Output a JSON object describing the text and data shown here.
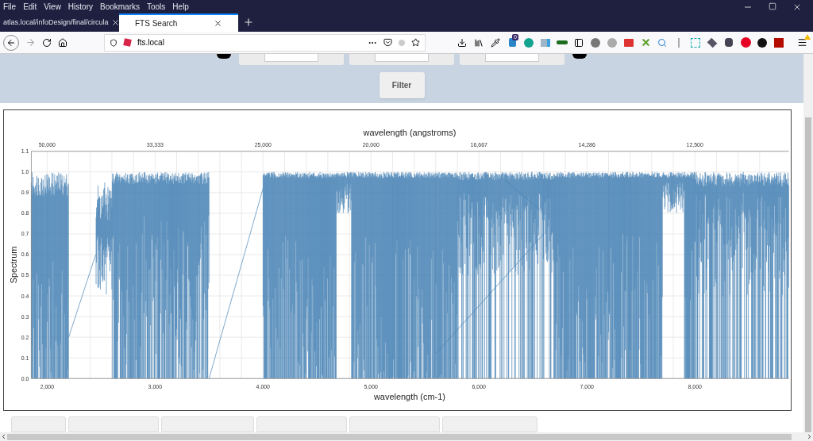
{
  "menu": [
    "File",
    "Edit",
    "View",
    "History",
    "Bookmarks",
    "Tools",
    "Help"
  ],
  "tabs": [
    {
      "label": "atlas.local/infoDesign/final/circula",
      "selected": false
    },
    {
      "label": "FTS Search",
      "selected": true
    }
  ],
  "address": {
    "url": "fts.local"
  },
  "extension_badge": "0",
  "filter": {
    "button": "Filter"
  },
  "chart": {
    "top_axis_title": "wavelength (angstroms)",
    "top_ticks": [
      "50,000",
      "33,333",
      "25,000",
      "20,000",
      "16,667",
      "14,286",
      "12,500"
    ],
    "y_label": "Spectrum",
    "y_ticks": [
      "1.1",
      "1.0",
      "0.9",
      "0.8",
      "0.7",
      "0.6",
      "0.5",
      "0.4",
      "0.3",
      "0.2",
      "0.1",
      "0.0"
    ],
    "x_label": "wavelength (cm-1)",
    "x_ticks": [
      "2,000",
      "3,000",
      "4,000",
      "5,000",
      "6,000",
      "7,000",
      "8,000"
    ]
  }
}
